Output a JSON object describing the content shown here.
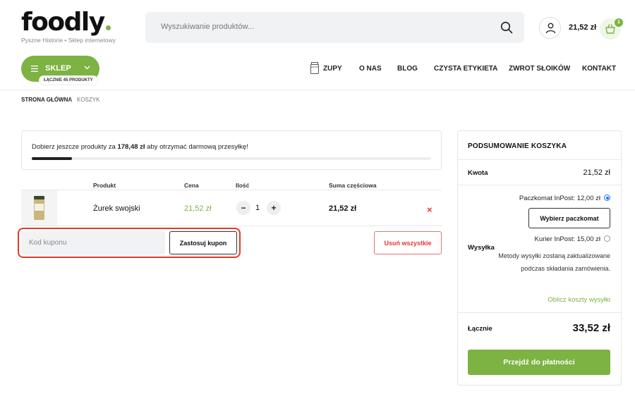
{
  "header": {
    "logo_text": "foodly",
    "tagline": "Pyszne Historie • Sklep internetowy",
    "search_placeholder": "Wyszukiwanie produktów...",
    "cart_total": "21,52 zł",
    "cart_count": "1"
  },
  "nav": {
    "shop_label": "SKLEP",
    "shop_products_pill": "ŁĄCZNIE 45 PRODUKTY",
    "links": [
      "ZUPY",
      "O NAS",
      "BLOG",
      "CZYSTA ETYKIETA",
      "ZWROT SŁOIKÓW",
      "KONTAKT"
    ]
  },
  "breadcrumb": {
    "home": "STRONA GŁÓWNA",
    "separator": ">",
    "current": "KOSZYK"
  },
  "free_shipping": {
    "text_before": "Dobierz jeszcze produkty za ",
    "amount": "178,48 zł",
    "text_after": " aby otrzymać darmową przesyłkę!",
    "progress": 0.1
  },
  "cart_table": {
    "columns": [
      "Produkt",
      "Cena",
      "Ilość",
      "Suma częściowa"
    ],
    "items": [
      {
        "name": "Żurek swojski",
        "price": "21,52 zł",
        "quantity": "1",
        "subtotal": "21,52 zł",
        "remove": "×"
      }
    ]
  },
  "coupon": {
    "placeholder": "Kod kuponu",
    "apply_label": "Zastosuj kupon",
    "clear_label": "Usuń wszystkie"
  },
  "summary": {
    "title": "PODSUMOWANIE KOSZYKA",
    "subtotal_label": "Kwota",
    "subtotal_value": "21,52 zł",
    "shipping_label": "Wysyłka",
    "option1": "Paczkomat InPost: 12,00 zł",
    "pick_locker": "Wybierz paczkomat",
    "option2": "Kurier InPost: 15,00 zł",
    "shipping_note": "Metody wysyłki zostaną zaktualizowane podczas składania zamówienia.",
    "calc_link": "Oblicz koszty wysyłki",
    "total_label": "Łącznie",
    "total_value": "33,52 zł",
    "checkout_label": "Przejdź do płatności"
  },
  "colors": {
    "brand_green": "#7cb342",
    "highlight_red": "#e53a26",
    "remove_red": "#e53935"
  }
}
